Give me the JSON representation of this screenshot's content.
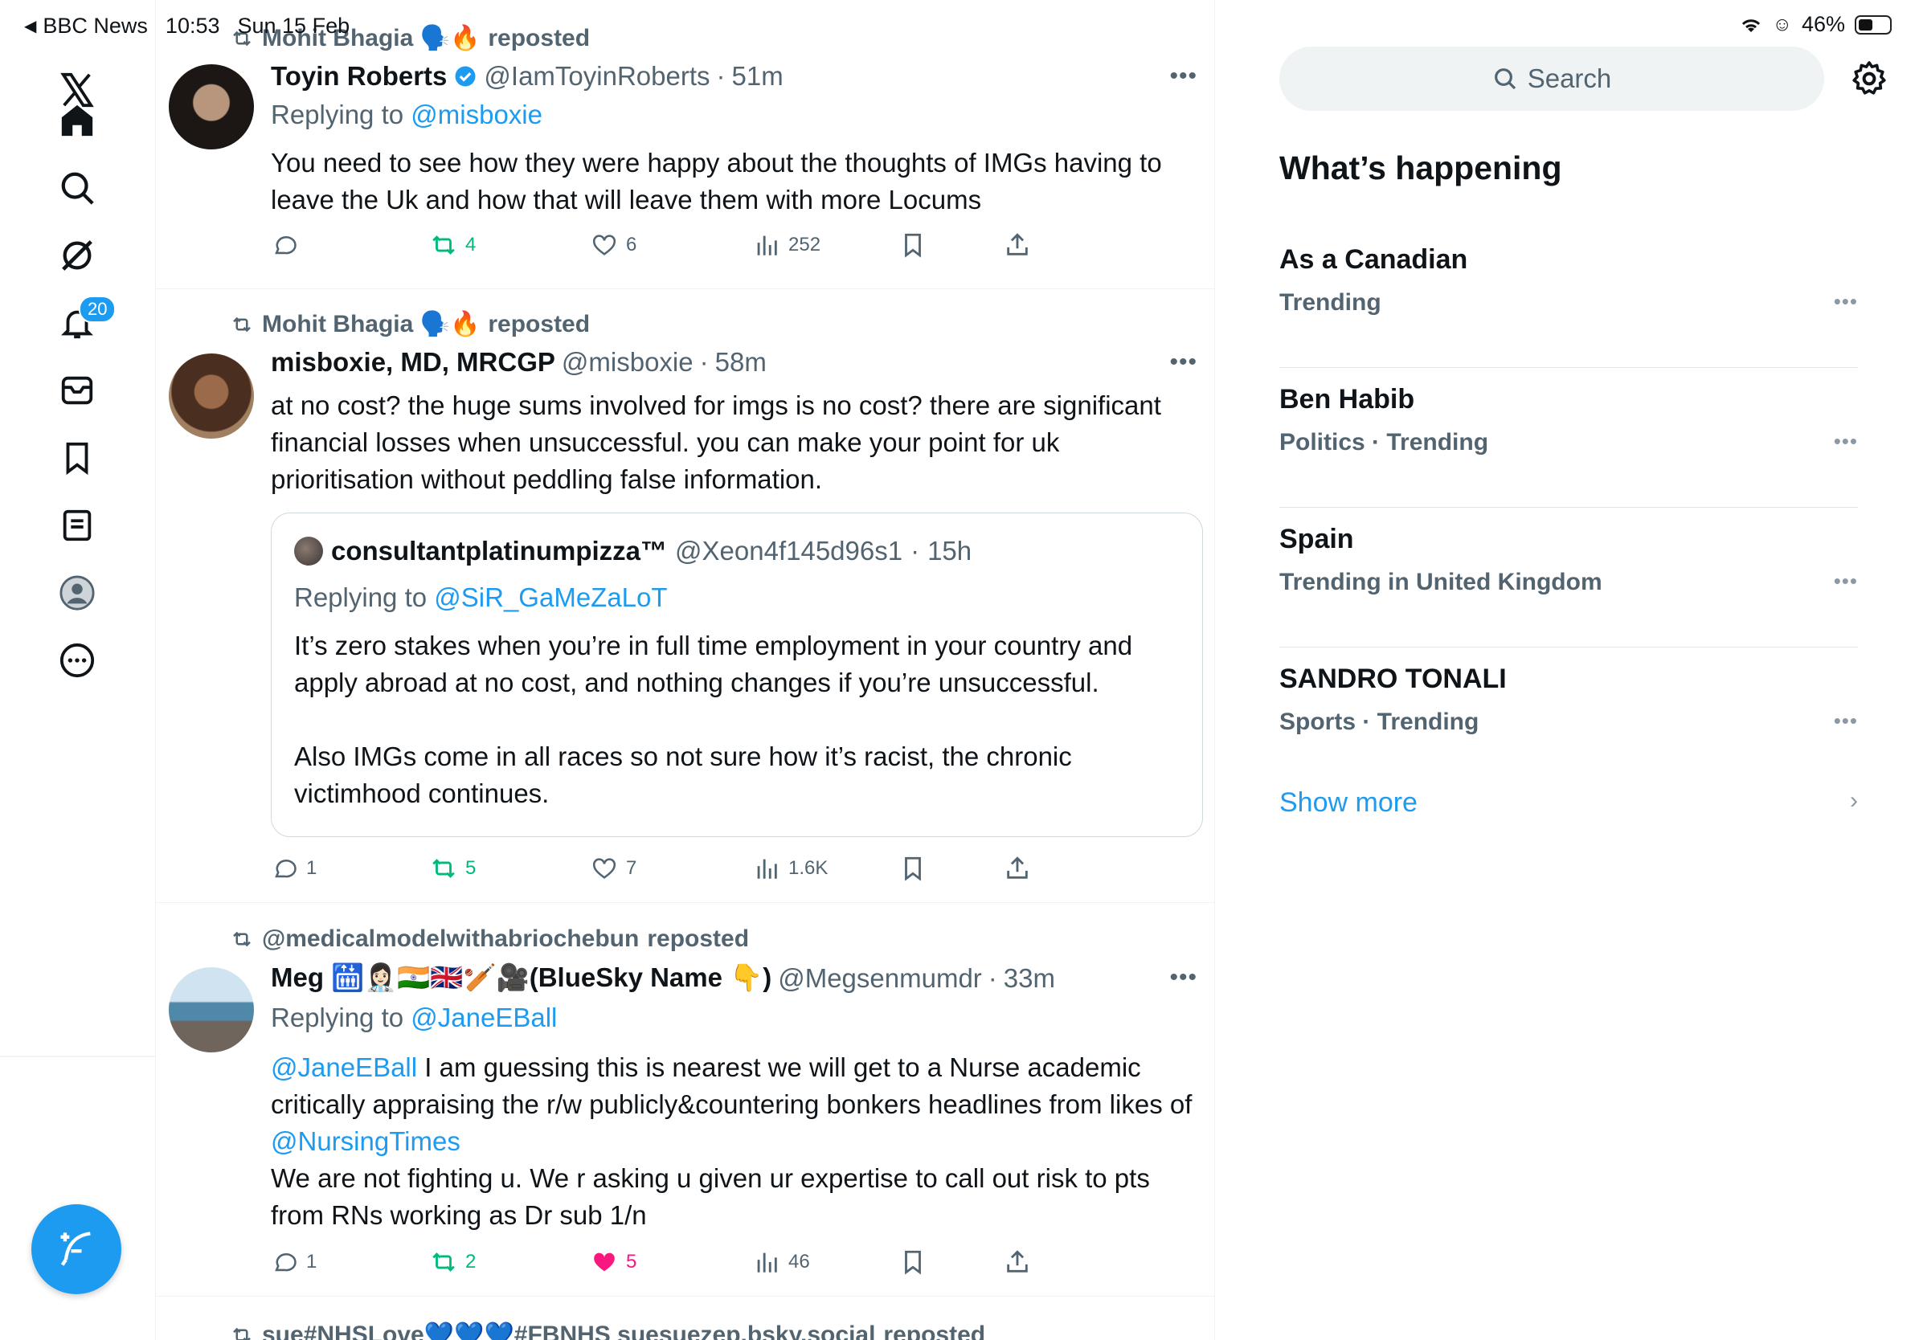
{
  "status_bar": {
    "back_app": "BBC News",
    "time": "10:53",
    "date": "Sun 15 Feb",
    "battery": "46%",
    "battery_level": 0.46
  },
  "nav": {
    "items": [
      "x-logo",
      "home",
      "explore",
      "grok",
      "notifications",
      "messages",
      "bookmarks",
      "lists",
      "profile",
      "more"
    ],
    "notifications_badge": "20"
  },
  "posts": [
    {
      "repost_by": "Mohit Bhagia 🗣️🔥",
      "repost_label": "reposted",
      "name": "Toyin Roberts",
      "verified": true,
      "handle": "@IamToyinRoberts",
      "time": "51m",
      "replying_prefix": "Replying to",
      "replying_to": "@misboxie",
      "text": "You need to see how they were happy about the thoughts of IMGs having to leave the Uk and how that will leave them with more Locums",
      "replies": "",
      "reposts": "4",
      "likes": "6",
      "views": "252"
    },
    {
      "repost_by": "Mohit Bhagia 🗣️🔥",
      "repost_label": "reposted",
      "name": "misboxie, MD, MRCGP",
      "handle": "@misboxie",
      "time": "58m",
      "text": "at no cost? the huge sums involved for imgs is no cost? there are significant financial losses when unsuccessful. you can make your point for uk prioritisation without peddling false information.",
      "quote": {
        "name": "consultantplatinumpizza™",
        "handle": "@Xeon4f145d96s1",
        "time": "15h",
        "replying_prefix": "Replying to",
        "replying_to": "@SiR_GaMeZaLoT",
        "para1": "It’s zero stakes when you’re in full time employment in your country and apply abroad at no cost, and nothing changes if you’re unsuccessful.",
        "para2": "Also IMGs come in all races so not sure how it’s racist, the chronic victimhood continues."
      },
      "replies": "1",
      "reposts": "5",
      "likes": "7",
      "views": "1.6K"
    },
    {
      "repost_by": "@medicalmodelwithabriochebun",
      "repost_label": "reposted",
      "name": "Meg 🛗👩🏻‍⚕️🇮🇳🇬🇧🏏🎥(BlueSky Name 👇)",
      "handle": "@Megsenmumdr",
      "time": "33m",
      "replying_prefix": "Replying to",
      "replying_to": "@JaneEBall",
      "mention": "@JaneEBall",
      "text_a": " I am guessing this is nearest we will get to a Nurse academic critically appraising the r/w publicly&countering bonkers headlines from likes of ",
      "mention2": "@NursingTimes",
      "text_b": "We are not fighting u. We r asking u given ur expertise to call out risk to pts from RNs working as Dr sub 1/n",
      "replies": "1",
      "reposts": "2",
      "likes": "5",
      "views": "46"
    },
    {
      "repost_by": "sue#NHSLove💙💙💙#FBNHS suesuezep.bsky.social",
      "repost_label": "reposted"
    }
  ],
  "sidebar": {
    "search_placeholder": "Search",
    "section_title": "What’s happening",
    "trends": [
      {
        "title": "As a Canadian",
        "meta": "Trending"
      },
      {
        "title": "Ben Habib",
        "meta": "Politics · Trending"
      },
      {
        "title": "Spain",
        "meta": "Trending in United Kingdom"
      },
      {
        "title": "SANDRO TONALI",
        "meta": "Sports · Trending"
      }
    ],
    "show_more": "Show more"
  },
  "colors": {
    "accent": "#1d9bf0",
    "repost_green": "#00ba7c",
    "like_pink": "#f91880",
    "secondary_text": "#536471"
  }
}
